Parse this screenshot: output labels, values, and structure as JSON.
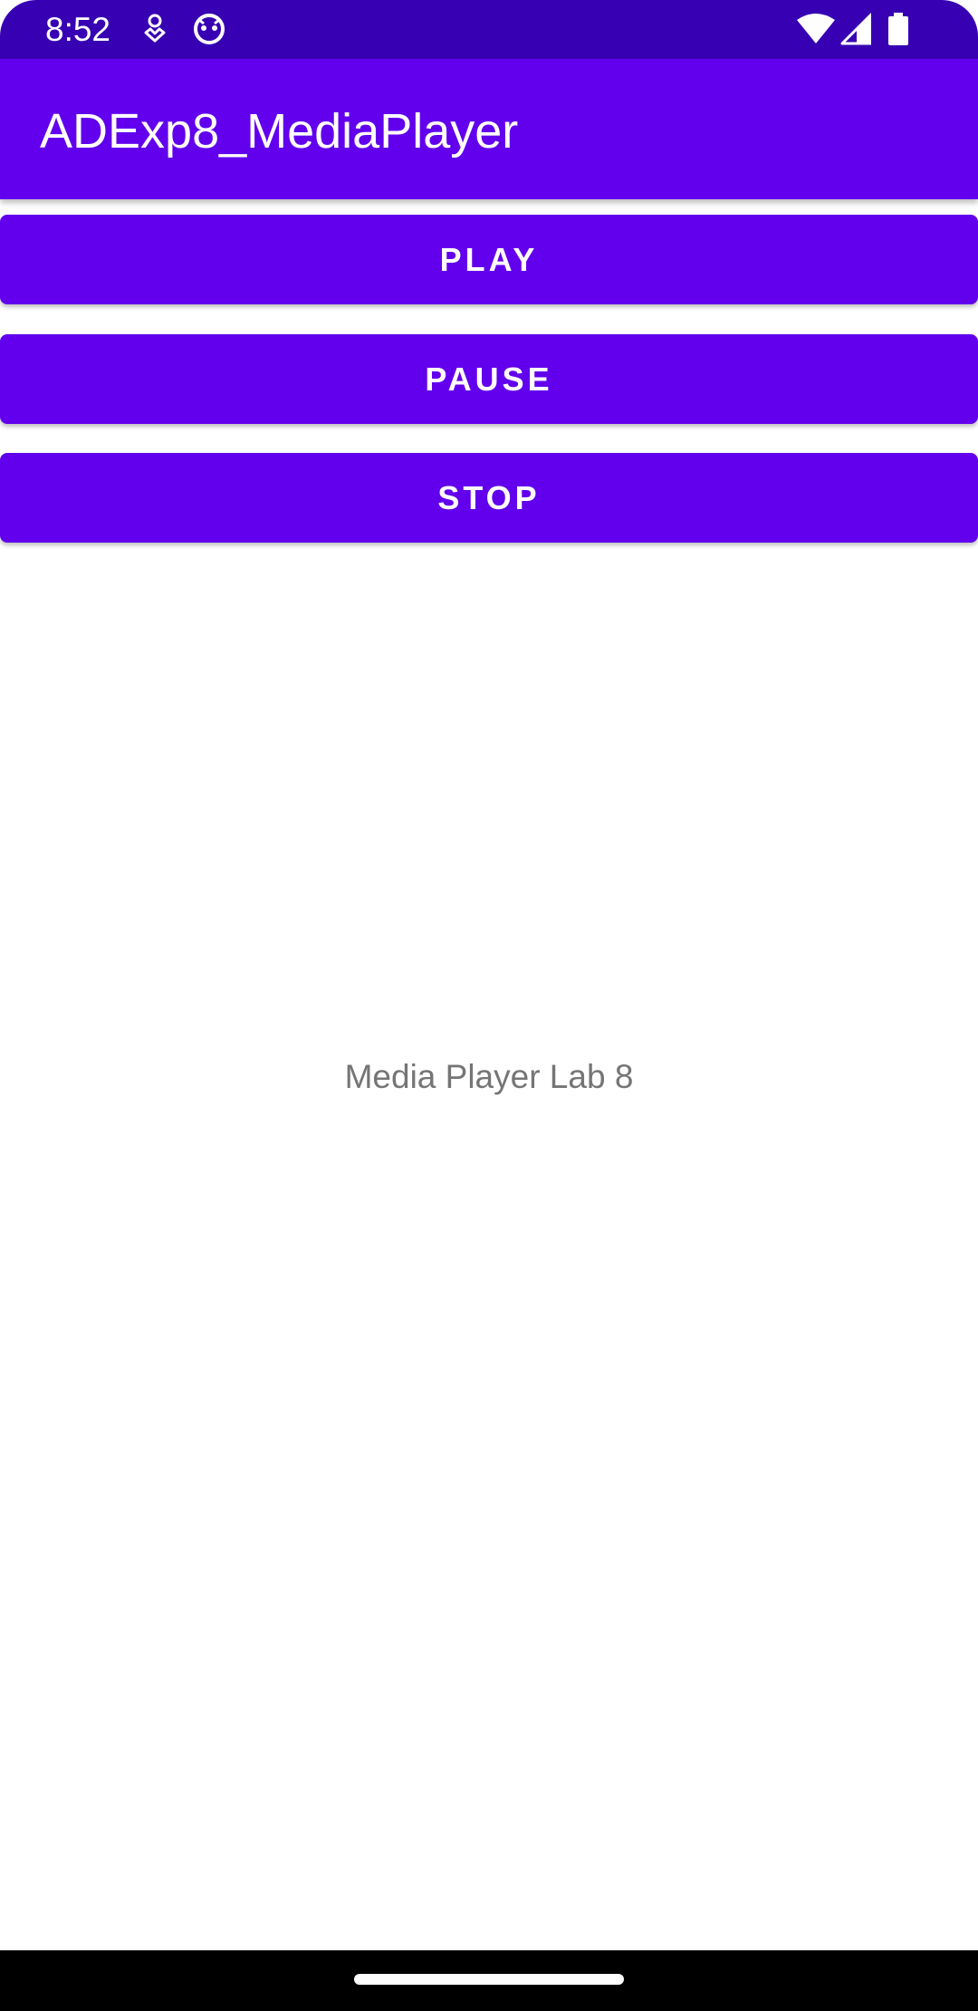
{
  "status_bar": {
    "time": "8:52",
    "icons": [
      "gesture-icon",
      "android-face-icon",
      "wifi-icon",
      "cell-signal-icon",
      "battery-icon"
    ],
    "background": "#3700b3"
  },
  "app_bar": {
    "title": "ADExp8_MediaPlayer",
    "background": "#6200ee"
  },
  "buttons": {
    "play": "PLAY",
    "pause": "PAUSE",
    "stop": "STOP"
  },
  "content": {
    "label": "Media Player Lab 8"
  },
  "colors": {
    "primary": "#6200ee",
    "primary_dark": "#3700b3",
    "text_secondary": "#757575"
  }
}
